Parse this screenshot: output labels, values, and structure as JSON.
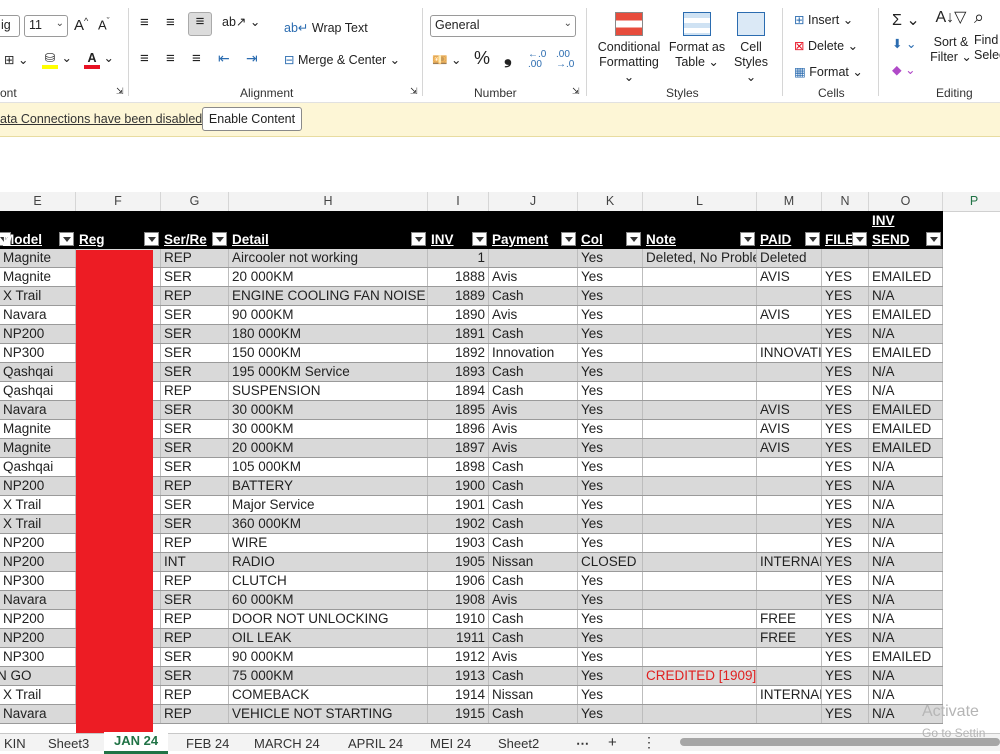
{
  "ribbon": {
    "font_name": "ig",
    "font_size": "11",
    "wrap_text": "Wrap Text",
    "merge_center": "Merge & Center",
    "number_format": "General",
    "conditional_formatting": [
      "Conditional",
      "Formatting ⌄"
    ],
    "format_as_table": [
      "Format as",
      "Table ⌄"
    ],
    "cell_styles": [
      "Cell",
      "Styles ⌄"
    ],
    "insert": "Insert",
    "delete": "Delete",
    "format": "Format",
    "sort_filter": [
      "Sort &",
      "Filter ⌄"
    ],
    "find_select": [
      "Find",
      "Selec"
    ],
    "groups": {
      "font": "ont",
      "alignment": "Alignment",
      "number": "Number",
      "styles": "Styles",
      "cells": "Cells",
      "editing": "Editing"
    }
  },
  "security_bar": {
    "message": "ata Connections have been disabled",
    "button": "Enable Content"
  },
  "column_letters": [
    "E",
    "F",
    "G",
    "H",
    "I",
    "J",
    "K",
    "L",
    "M",
    "N",
    "O",
    "P"
  ],
  "selected_column": "P",
  "table": {
    "headers": [
      "Model",
      "Reg",
      "Ser/Re",
      "Detail",
      "INV",
      "Payment",
      "Col",
      "Note",
      "PAID",
      "FILE",
      "INV SEND"
    ],
    "rows": [
      [
        "Magnite",
        "",
        "REP",
        "Aircooler not working",
        "1",
        "",
        "Yes",
        "Deleted, No Problem",
        "Deleted",
        "",
        ""
      ],
      [
        "Magnite",
        "",
        "SER",
        "20 000KM",
        "1888",
        "Avis",
        "Yes",
        "",
        "AVIS",
        "YES",
        "EMAILED"
      ],
      [
        "X Trail",
        "",
        "REP",
        "ENGINE COOLING FAN NOISE",
        "1889",
        "Cash",
        "Yes",
        "",
        "",
        "YES",
        "N/A"
      ],
      [
        "Navara",
        "",
        "SER",
        "90 000KM",
        "1890",
        "Avis",
        "Yes",
        "",
        "AVIS",
        "YES",
        "EMAILED"
      ],
      [
        "NP200",
        "",
        "SER",
        "180 000KM",
        "1891",
        "Cash",
        "Yes",
        "",
        "",
        "YES",
        "N/A"
      ],
      [
        "NP300",
        "",
        "SER",
        "150 000KM",
        "1892",
        "Innovation",
        "Yes",
        "",
        "INNOVATIO",
        "YES",
        "EMAILED"
      ],
      [
        "Qashqai",
        "",
        "SER",
        "195 000KM Service",
        "1893",
        "Cash",
        "Yes",
        "",
        "",
        "YES",
        "N/A"
      ],
      [
        "Qashqai",
        "",
        "REP",
        "SUSPENSION",
        "1894",
        "Cash",
        "Yes",
        "",
        "",
        "YES",
        "N/A"
      ],
      [
        "Navara",
        "",
        "SER",
        "30 000KM",
        "1895",
        "Avis",
        "Yes",
        "",
        "AVIS",
        "YES",
        "EMAILED"
      ],
      [
        "Magnite",
        "",
        "SER",
        "30 000KM",
        "1896",
        "Avis",
        "Yes",
        "",
        "AVIS",
        "YES",
        "EMAILED"
      ],
      [
        "Magnite",
        "",
        "SER",
        "20 000KM",
        "1897",
        "Avis",
        "Yes",
        "",
        "AVIS",
        "YES",
        "EMAILED"
      ],
      [
        "Qashqai",
        "",
        "SER",
        "105 000KM",
        "1898",
        "Cash",
        "Yes",
        "",
        "",
        "YES",
        "N/A"
      ],
      [
        "NP200",
        "",
        "REP",
        "BATTERY",
        "1900",
        "Cash",
        "Yes",
        "",
        "",
        "YES",
        "N/A"
      ],
      [
        "X Trail",
        "",
        "SER",
        "Major Service",
        "1901",
        "Cash",
        "Yes",
        "",
        "",
        "YES",
        "N/A"
      ],
      [
        "X Trail",
        "",
        "SER",
        "360 000KM",
        "1902",
        "Cash",
        "Yes",
        "",
        "",
        "YES",
        "N/A"
      ],
      [
        "NP200",
        "",
        "REP",
        "WIRE",
        "1903",
        "Cash",
        "Yes",
        "",
        "",
        "YES",
        "N/A"
      ],
      [
        "NP200",
        "",
        "INT",
        "RADIO",
        "1905",
        "Nissan",
        "CLOSED",
        "",
        "INTERNAL",
        "YES",
        "N/A"
      ],
      [
        "NP300",
        "",
        "REP",
        "CLUTCH",
        "1906",
        "Cash",
        "Yes",
        "",
        "",
        "YES",
        "N/A"
      ],
      [
        "Navara",
        "",
        "SER",
        "60 000KM",
        "1908",
        "Avis",
        "Yes",
        "",
        "",
        "YES",
        "N/A"
      ],
      [
        "NP200",
        "",
        "REP",
        "DOOR NOT UNLOCKING",
        "1910",
        "Cash",
        "Yes",
        "",
        "FREE",
        "YES",
        "N/A"
      ],
      [
        "NP200",
        "",
        "REP",
        "OIL LEAK",
        "1911",
        "Cash",
        "Yes",
        "",
        "FREE",
        "YES",
        "N/A"
      ],
      [
        "NP300",
        "",
        "SER",
        "90 000KM",
        "1912",
        "Avis",
        "Yes",
        "",
        "",
        "YES",
        "EMAILED"
      ],
      [
        "N GO",
        "",
        "SER",
        "75 000KM",
        "1913",
        "Cash",
        "Yes",
        "CREDITED [1909]",
        "",
        "YES",
        "N/A"
      ],
      [
        "X Trail",
        "",
        "REP",
        "COMEBACK",
        "1914",
        "Nissan",
        "Yes",
        "",
        "INTERNAL",
        "YES",
        "N/A"
      ],
      [
        "Navara",
        "",
        "REP",
        "VEHICLE NOT STARTING",
        "1915",
        "Cash",
        "Yes",
        "",
        "",
        "YES",
        "N/A"
      ]
    ]
  },
  "sheet_tabs": [
    "KIN",
    "Sheet3",
    "JAN 24",
    "FEB 24",
    "MARCH 24",
    "APRIL 24",
    "MEI 24",
    "Sheet2"
  ],
  "active_tab": "JAN 24",
  "watermark": {
    "line1": "Activate",
    "line2": "Go to Settin"
  },
  "colors": {
    "header_bg": "#000000",
    "band_gray": "#d9d9d9",
    "redaction": "#ed1c24",
    "credit_red": "#e02020",
    "excel_green": "#217346"
  }
}
